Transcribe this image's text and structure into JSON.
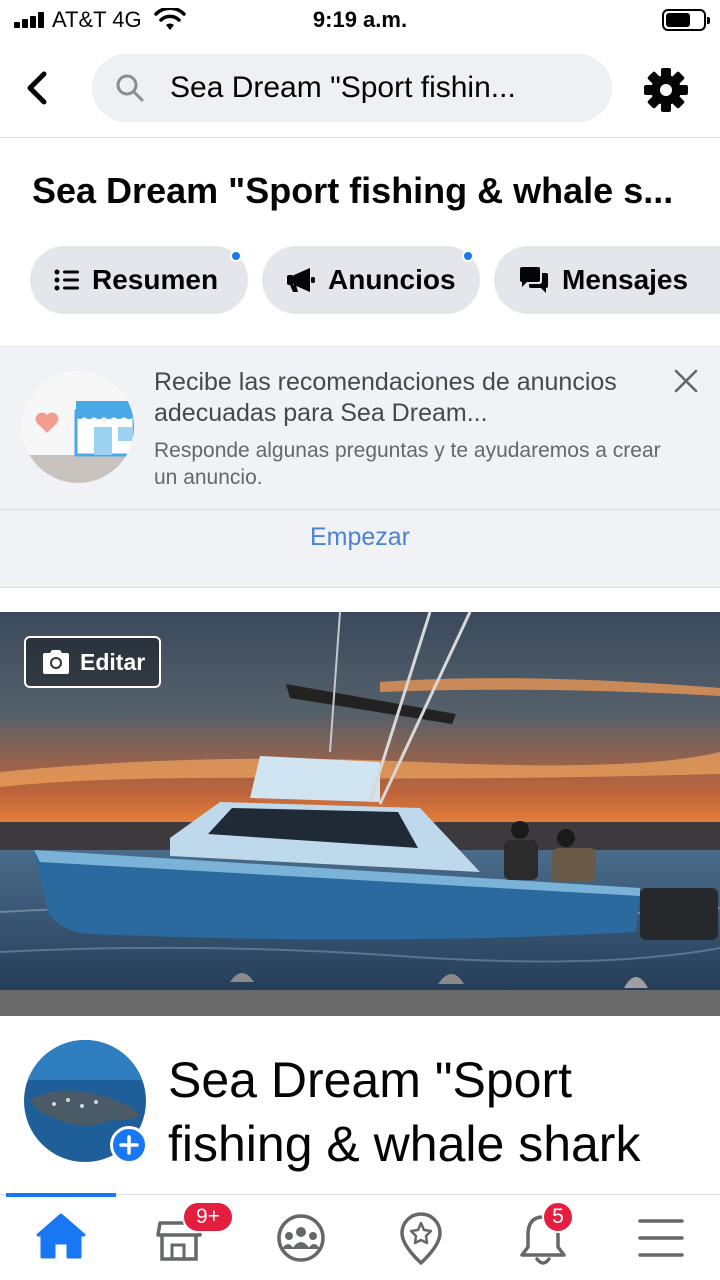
{
  "status_bar": {
    "carrier": "AT&T 4G",
    "time": "9:19 a.m."
  },
  "header": {
    "search_text": "Sea Dream \"Sport fishin...",
    "back_icon": "chevron-left-icon",
    "settings_icon": "gear-icon"
  },
  "page": {
    "title": "Sea Dream \"Sport fishing & whale s..."
  },
  "tabs": [
    {
      "label": "Resumen",
      "icon": "list-icon",
      "has_dot": true
    },
    {
      "label": "Anuncios",
      "icon": "megaphone-icon",
      "has_dot": true
    },
    {
      "label": "Mensajes",
      "icon": "chat-icon",
      "has_dot": false
    }
  ],
  "recommendation": {
    "title": "Recibe las recomendaciones de anuncios adecuadas para Sea Dream...",
    "subtitle": "Responde algunas preguntas y te ayudaremos a crear un anuncio.",
    "action": "Empezar"
  },
  "cover": {
    "edit_label": "Editar"
  },
  "profile": {
    "name": "Sea Dream \"Sport fishing & whale shark tours\""
  },
  "bottom_nav": {
    "items": [
      {
        "icon": "home-icon",
        "active": true
      },
      {
        "icon": "marketplace-icon",
        "badge": "9+"
      },
      {
        "icon": "groups-icon"
      },
      {
        "icon": "pages-icon"
      },
      {
        "icon": "bell-icon",
        "badge": "5"
      },
      {
        "icon": "menu-icon"
      }
    ]
  },
  "colors": {
    "accent": "#1877f2",
    "badge": "#e41e3f",
    "link": "#4a82d6"
  }
}
